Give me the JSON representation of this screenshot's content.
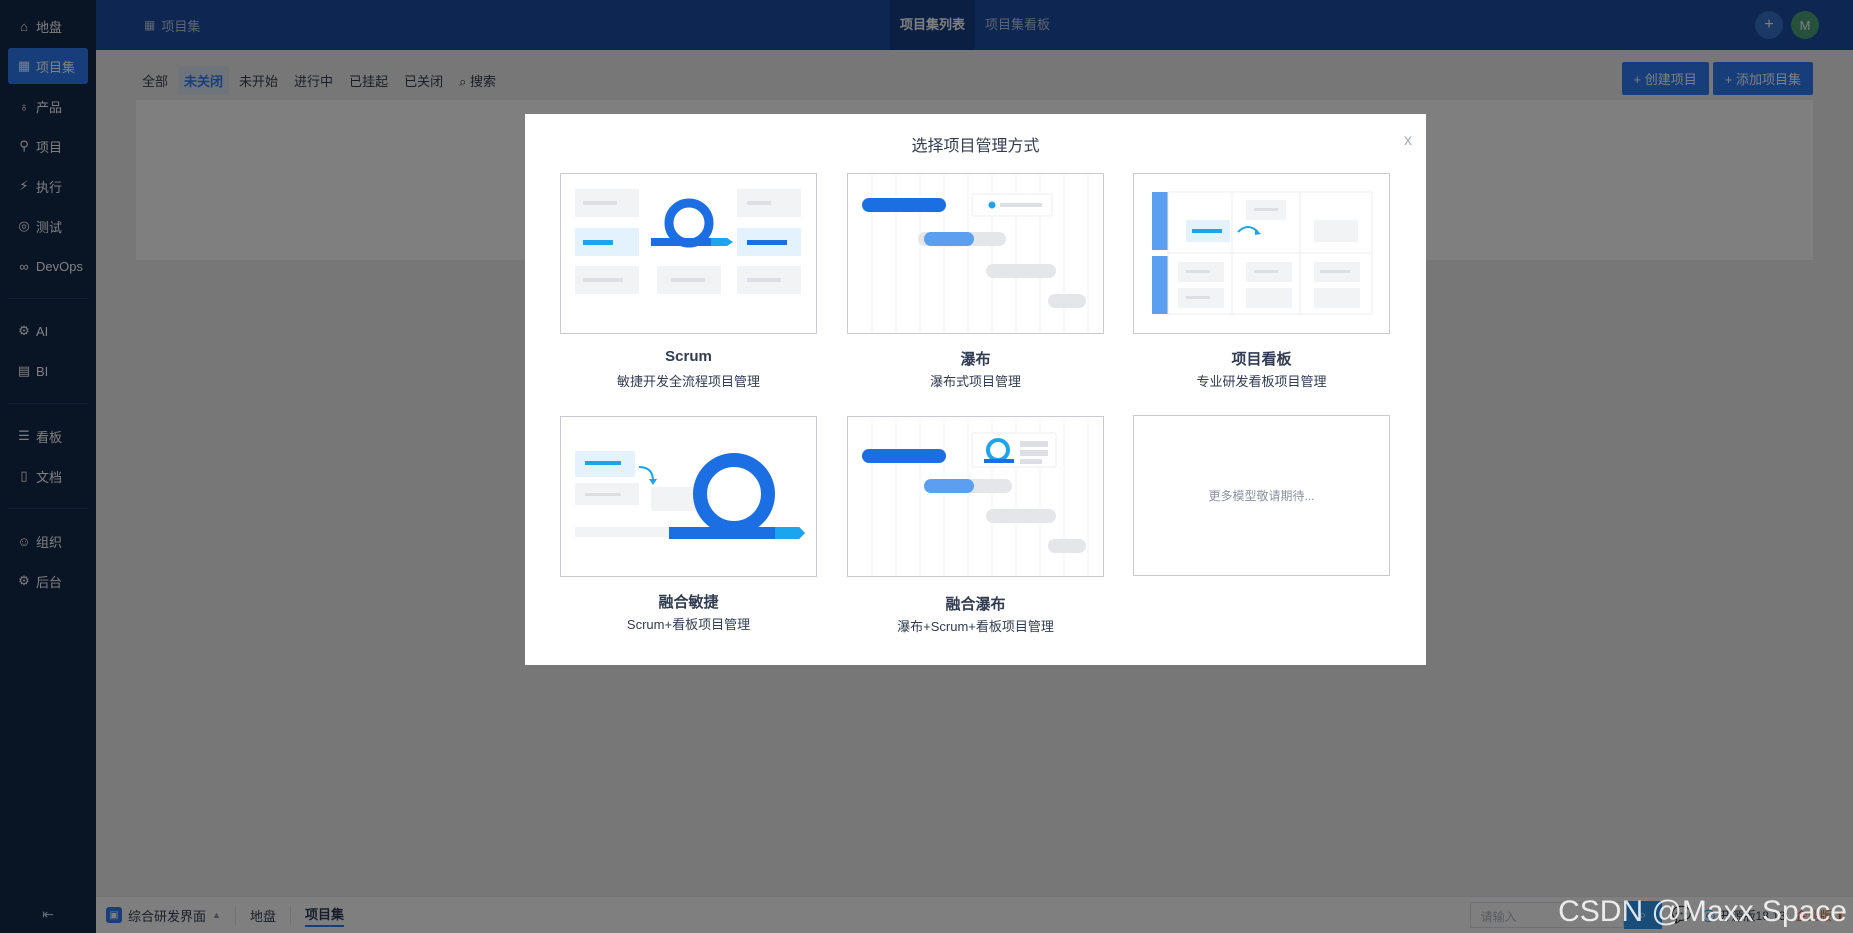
{
  "sidebar": {
    "items": [
      {
        "label": "地盘",
        "icon": "home-icon"
      },
      {
        "label": "项目集",
        "icon": "grid-icon",
        "active": true
      },
      {
        "label": "产品",
        "icon": "bulb-icon"
      },
      {
        "label": "项目",
        "icon": "rocket-icon"
      },
      {
        "label": "执行",
        "icon": "run-icon"
      },
      {
        "label": "测试",
        "icon": "search-bug-icon"
      },
      {
        "label": "DevOps",
        "icon": "infinity-icon"
      },
      {
        "label": "AI",
        "icon": "robot-icon"
      },
      {
        "label": "BI",
        "icon": "chart-icon"
      },
      {
        "label": "看板",
        "icon": "board-icon"
      },
      {
        "label": "文档",
        "icon": "doc-icon"
      },
      {
        "label": "组织",
        "icon": "people-icon"
      },
      {
        "label": "后台",
        "icon": "gear-icon"
      }
    ],
    "collapse": "⇤"
  },
  "header": {
    "crumb": "项目集",
    "tabs": [
      "项目集列表",
      "项目集看板"
    ],
    "avatar": "M"
  },
  "main": {
    "filters": [
      "全部",
      "未关闭",
      "未开始",
      "进行中",
      "已挂起",
      "已关闭",
      "搜索"
    ],
    "actions": [
      "创建项目",
      "添加项目集"
    ]
  },
  "footer": {
    "app": "综合研发界面",
    "crumbs": [
      "地盘",
      "项目集"
    ],
    "search_placeholder": "请输入",
    "version": "开源版18.13",
    "enterprise": "企业版"
  },
  "modal": {
    "title": "选择项目管理方式",
    "close": "x",
    "cards": [
      {
        "name": "Scrum",
        "desc": "敏捷开发全流程项目管理"
      },
      {
        "name": "瀑布",
        "desc": "瀑布式项目管理"
      },
      {
        "name": "项目看板",
        "desc": "专业研发看板项目管理"
      },
      {
        "name": "融合敏捷",
        "desc": "Scrum+看板项目管理"
      },
      {
        "name": "融合瀑布",
        "desc": "瀑布+Scrum+看板项目管理"
      }
    ],
    "coming_soon": "更多模型敬请期待..."
  },
  "watermark": "CSDN @Maxx Space",
  "colors": {
    "brand": "#2e7cf6",
    "header": "#1c4fa5",
    "sidebar": "#12284a"
  }
}
